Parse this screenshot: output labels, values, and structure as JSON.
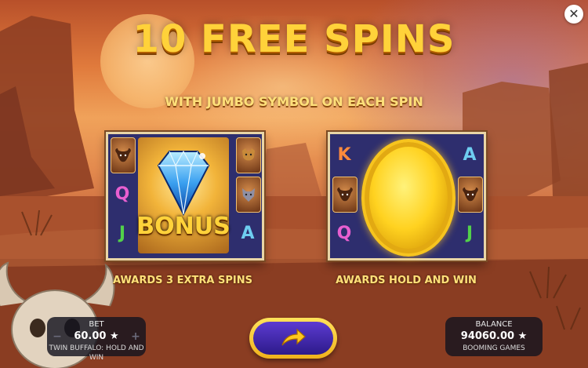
{
  "header": {
    "title": "10 FREE SPINS",
    "subtitle": "WITH JUMBO SYMBOL ON EACH SPIN"
  },
  "panels": [
    {
      "left_symbols": [
        "buffalo",
        "Q",
        "J"
      ],
      "right_symbols": [
        "cougar",
        "wolf",
        "A"
      ],
      "jumbo_symbol": "diamond",
      "jumbo_label": "BONUS",
      "award": "AWARDS 3 EXTRA SPINS"
    },
    {
      "left_symbols": [
        "K",
        "buffalo",
        "Q"
      ],
      "right_symbols": [
        "A",
        "buffalo",
        "J"
      ],
      "jumbo_symbol": "gold-coin",
      "award": "AWARDS HOLD AND WIN"
    }
  ],
  "bet": {
    "caption": "BET",
    "value": "60.00 ★",
    "game_name": "TWIN BUFFALO: HOLD AND WIN",
    "minus": "−",
    "plus": "+"
  },
  "balance": {
    "caption": "BALANCE",
    "value": "94060.00 ★",
    "provider": "BOOMING GAMES"
  },
  "controls": {
    "close": "✕",
    "continue_icon": "arrow-right-icon"
  },
  "colors": {
    "gold": "#ffd23a",
    "reel_bg": "#2e2e6e",
    "button_purple": "#3d22a8"
  }
}
